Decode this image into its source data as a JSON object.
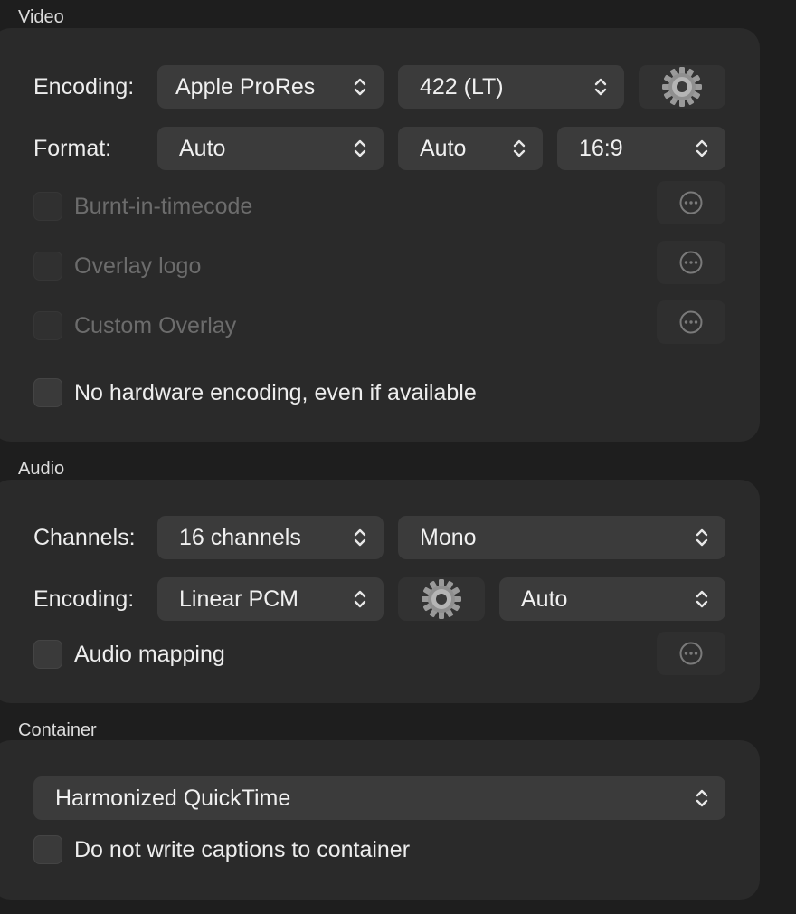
{
  "video": {
    "title": "Video",
    "encoding_label": "Encoding:",
    "encoding_codec": "Apple ProRes",
    "encoding_profile": "422 (LT)",
    "format_label": "Format:",
    "format_value": "Auto",
    "format_rate": "Auto",
    "format_aspect": "16:9",
    "options": [
      {
        "label": "Burnt-in-timecode",
        "checked": false,
        "enabled": false
      },
      {
        "label": "Overlay logo",
        "checked": false,
        "enabled": false
      },
      {
        "label": "Custom Overlay",
        "checked": false,
        "enabled": false
      }
    ],
    "no_hw_label": "No hardware encoding, even if available"
  },
  "audio": {
    "title": "Audio",
    "channels_label": "Channels:",
    "channels_value": "16 channels",
    "channels_layout": "Mono",
    "encoding_label": "Encoding:",
    "encoding_value": "Linear PCM",
    "encoding_rate": "Auto",
    "mapping_label": "Audio mapping"
  },
  "container": {
    "title": "Container",
    "format_value": "Harmonized QuickTime",
    "no_captions_label": "Do not write captions to container"
  },
  "icons": {
    "gear": "gear-icon",
    "more": "ellipsis-circle-icon",
    "chevron": "chevron-up-down-icon"
  }
}
